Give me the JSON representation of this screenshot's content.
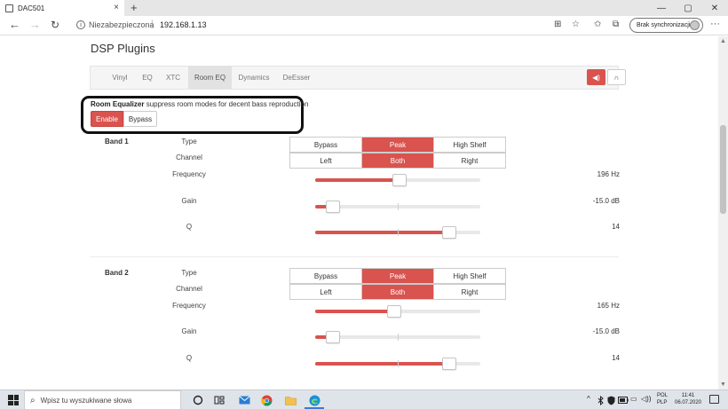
{
  "browser": {
    "tab_title": "DAC501",
    "new_tab": "+",
    "tab_close": "×",
    "not_secure": "Niezabezpieczona",
    "url_separator": "|",
    "url": "192.168.1.13",
    "sync_label": "Brak synchronizacji",
    "glyphs": {
      "back": "←",
      "forward": "→",
      "reload": "↻",
      "info": "i",
      "translate": "⊞",
      "favorite": "☆",
      "favorites_list": "✩",
      "collections": "⧉",
      "more": "···",
      "minimize": "—",
      "maximize": "▢",
      "close": "✕"
    }
  },
  "page": {
    "title": "DSP Plugins",
    "tabs": [
      "Vinyl",
      "EQ",
      "XTC",
      "Room EQ",
      "Dynamics",
      "DeEsser"
    ],
    "active_tab": "Room EQ",
    "tool_icons": {
      "speaker": "◀)",
      "headphones": "∩"
    },
    "plugin": {
      "name": "Room Equalizer",
      "description": "suppress room modes for decent bass reproduction",
      "enable_label": "Enable",
      "bypass_label": "Bypass",
      "enabled": true
    },
    "labels": {
      "type": "Type",
      "channel": "Channel",
      "frequency": "Frequency",
      "gain": "Gain",
      "q": "Q"
    },
    "type_options": [
      "Bypass",
      "Peak",
      "High Shelf"
    ],
    "channel_options": [
      "Left",
      "Both",
      "Right"
    ],
    "bands": [
      {
        "title": "Band 1",
        "type": "Peak",
        "channel": "Both",
        "frequency": {
          "display": "196 Hz",
          "position": 0.51
        },
        "gain": {
          "display": "-15.0 dB",
          "position": 0.11
        },
        "q": {
          "display": "14",
          "position": 0.81
        }
      },
      {
        "title": "Band 2",
        "type": "Peak",
        "channel": "Both",
        "frequency": {
          "display": "165 Hz",
          "position": 0.48
        },
        "gain": {
          "display": "-15.0 dB",
          "position": 0.11
        },
        "q": {
          "display": "14",
          "position": 0.81
        }
      }
    ],
    "accent_color": "#d9534f"
  },
  "taskbar": {
    "search_placeholder": "Wpisz tu wyszukiwane słowa",
    "icons": [
      "task-view-icon",
      "widgets-icon",
      "mail-icon",
      "chrome-icon",
      "file-explorer-icon",
      "edge-icon"
    ],
    "language": [
      "POL",
      "PLP"
    ],
    "time": "11:41",
    "date": "06.07.2020",
    "tray_glyphs": {
      "chevron": "^",
      "network": "▭",
      "volume": "◁))"
    }
  }
}
